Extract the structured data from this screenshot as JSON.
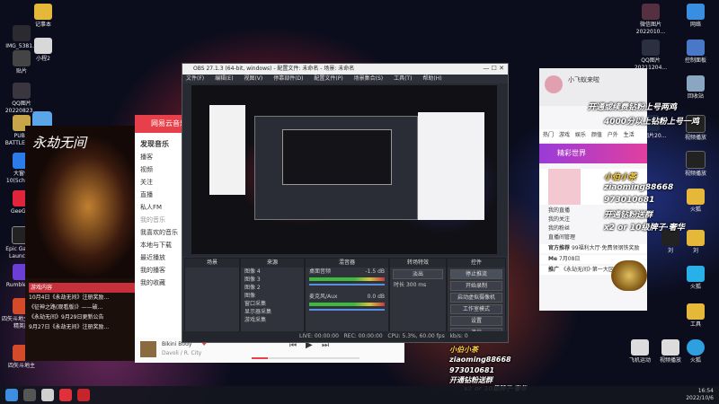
{
  "desktop": {
    "left_icons": [
      "IMG_5381...",
      "贴片",
      "QQ图片20220823...",
      "PUBG BATTLEGR...",
      "大窗体10(5chun...",
      "GeeGee",
      "Epic Games Launcher",
      "Rumblem...",
      "四矢斗地主·手游精英版",
      "四矢斗地主"
    ],
    "top_icons": [
      "记事本",
      "小程2"
    ],
    "right_icons": [
      "微信图片2022010...",
      "网络",
      "QQ图片20211204...",
      "控制面板",
      "回收站",
      "视频播放",
      "QQ图片20...",
      "视频播放",
      "火狐",
      "刘",
      "火狐",
      "工具",
      "飞机运动",
      "视频播放",
      "火狐",
      "刘"
    ]
  },
  "taskbar": {
    "time": "16:54",
    "date": "2022/10/6"
  },
  "music_app": {
    "title": "网易云音乐",
    "nav": [
      "发现音乐",
      "播客",
      "视频",
      "关注",
      "直播",
      "私人FM",
      "我的音乐",
      "我喜欢的音乐",
      "本地与下载",
      "最近播放",
      "我的播客",
      "我的收藏"
    ],
    "song": "Bikini Body",
    "artist": "Davoli / R. City",
    "progress": 0.15
  },
  "game": {
    "logo": "永劫无间",
    "news_header": "游戏内容",
    "news": [
      "10月4日《永劫无间》注册奖励...",
      "《征神之路(观看版)》——破...",
      "《永劫无间》9月29日更新公告",
      "9月27日《永劫无间》注册奖励..."
    ]
  },
  "obs": {
    "title": "OBS 27.1.3 (64-bit, windows) - 配置文件: 未命名 - 场景: 未命名",
    "menu": [
      "文件(F)",
      "编辑(E)",
      "视图(V)",
      "停靠部件(D)",
      "配置文件(P)",
      "场景集合(S)",
      "工具(T)",
      "帮助(H)"
    ],
    "scene_label": "场景",
    "sources_label": "来源",
    "mixer_label": "混音器",
    "transition_label": "转场特效",
    "controls_label": "控件",
    "sources": [
      "图像 4",
      "图像 3",
      "图像 2",
      "图像",
      "窗口采集",
      "显示器采集",
      "游戏采集"
    ],
    "mixer": [
      {
        "name": "桌面音频",
        "db": "-1.5 dB"
      },
      {
        "name": "麦克风/Aux",
        "db": "0.0 dB"
      }
    ],
    "transition": "淡出",
    "duration_label": "时长",
    "duration": "300 ms",
    "controls": [
      "停止推流",
      "开始录制",
      "启动虚拟摄像机",
      "工作室模式",
      "设置",
      "退出"
    ],
    "status": {
      "live": "LIVE: 00:00:00",
      "rec": "REC: 00:00:00",
      "cpu": "CPU: 5.3%, 60.00 fps",
      "kbps": "kb/s: 0"
    }
  },
  "chat_app": {
    "streamer": "小飞蚁来啦",
    "tabs": [
      "热门",
      "游戏",
      "娱乐",
      "颜值",
      "户外",
      "生活"
    ],
    "banner": "精彩世界",
    "items": [
      "我的直播",
      "我的关注",
      "我的粉丝",
      "直播间管理"
    ],
    "messages": [
      {
        "user": "官方推荐",
        "text": "99福利大厅·免费领钢铁奖励"
      },
      {
        "user": "Me",
        "text": "7月08日"
      },
      {
        "user": "推广",
        "text": "《永劫无间》·第一大区..."
      }
    ]
  },
  "overlay": {
    "lines_right": [
      "开通或续费钻粉上号两鸡",
      "4000分以上钻粉上号一鸡"
    ],
    "donors": [
      "小伯小茶",
      "ziaoming88668",
      "973010681",
      "开通钻粉送群",
      "x2 or 10级牌子·奢华"
    ]
  }
}
